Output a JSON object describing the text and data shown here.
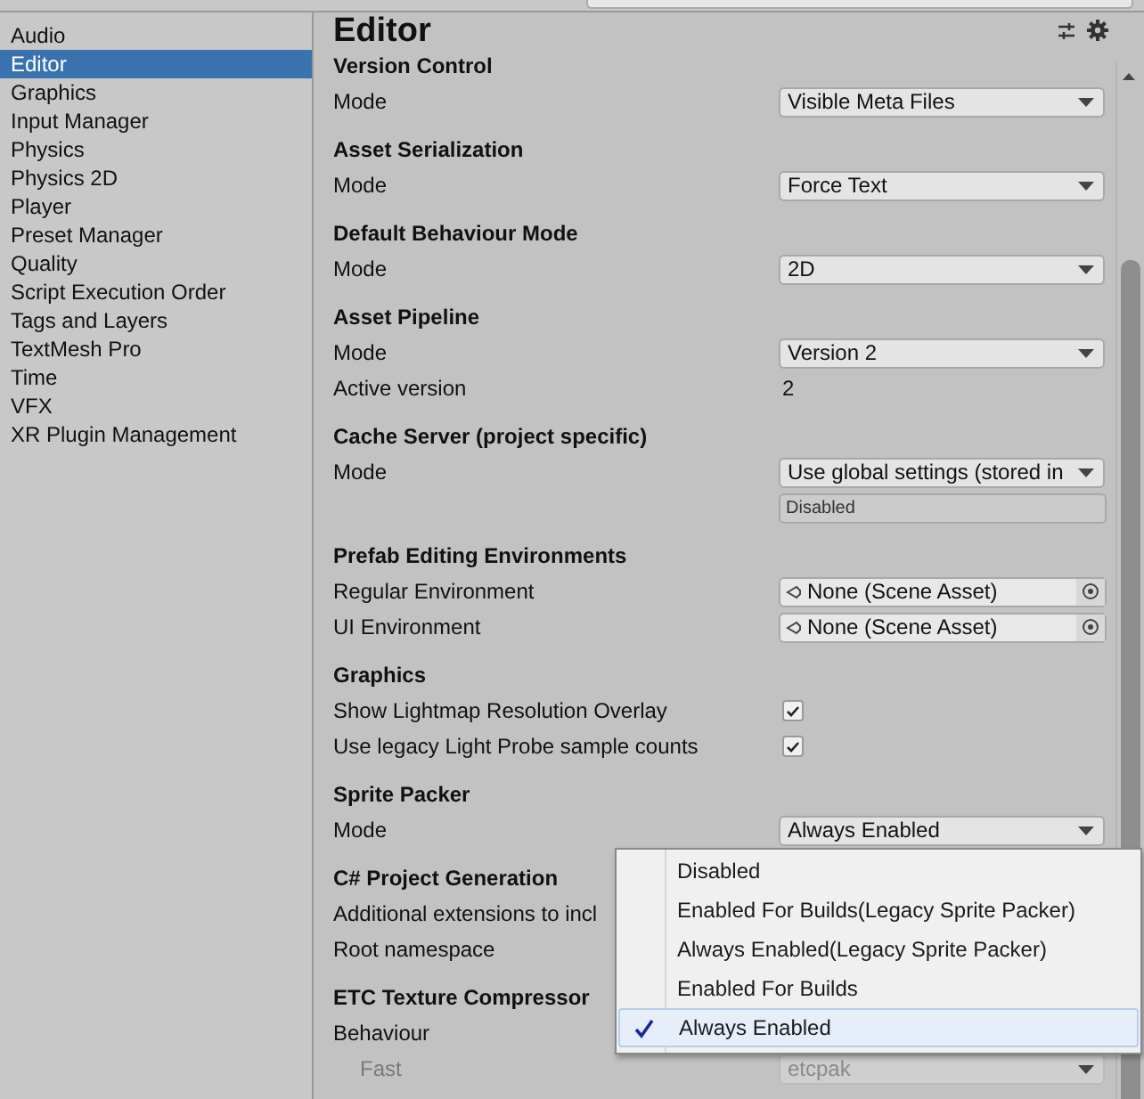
{
  "sidebar": {
    "items": [
      {
        "label": "Audio",
        "selected": false
      },
      {
        "label": "Editor",
        "selected": true
      },
      {
        "label": "Graphics",
        "selected": false
      },
      {
        "label": "Input Manager",
        "selected": false
      },
      {
        "label": "Physics",
        "selected": false
      },
      {
        "label": "Physics 2D",
        "selected": false
      },
      {
        "label": "Player",
        "selected": false
      },
      {
        "label": "Preset Manager",
        "selected": false
      },
      {
        "label": "Quality",
        "selected": false
      },
      {
        "label": "Script Execution Order",
        "selected": false
      },
      {
        "label": "Tags and Layers",
        "selected": false
      },
      {
        "label": "TextMesh Pro",
        "selected": false
      },
      {
        "label": "Time",
        "selected": false
      },
      {
        "label": "VFX",
        "selected": false
      },
      {
        "label": "XR Plugin Management",
        "selected": false
      }
    ]
  },
  "panel": {
    "title": "Editor",
    "sections": [
      {
        "title": "Version Control",
        "rows": [
          {
            "kind": "dropdown",
            "label": "Mode",
            "value": "Visible Meta Files"
          }
        ]
      },
      {
        "title": "Asset Serialization",
        "rows": [
          {
            "kind": "dropdown",
            "label": "Mode",
            "value": "Force Text"
          }
        ]
      },
      {
        "title": "Default Behaviour Mode",
        "rows": [
          {
            "kind": "dropdown",
            "label": "Mode",
            "value": "2D"
          }
        ]
      },
      {
        "title": "Asset Pipeline",
        "rows": [
          {
            "kind": "dropdown",
            "label": "Mode",
            "value": "Version 2"
          },
          {
            "kind": "text",
            "label": "Active version",
            "value": "2"
          }
        ]
      },
      {
        "title": "Cache Server (project specific)",
        "rows": [
          {
            "kind": "dropdown",
            "label": "Mode",
            "value": "Use global settings (stored in"
          },
          {
            "kind": "status",
            "value": "Disabled"
          }
        ]
      },
      {
        "title": "Prefab Editing Environments",
        "rows": [
          {
            "kind": "object",
            "label": "Regular Environment",
            "value": "None (Scene Asset)"
          },
          {
            "kind": "object",
            "label": "UI Environment",
            "value": "None (Scene Asset)"
          }
        ]
      },
      {
        "title": "Graphics",
        "rows": [
          {
            "kind": "checkbox",
            "label": "Show Lightmap Resolution Overlay",
            "checked": true
          },
          {
            "kind": "checkbox",
            "label": "Use legacy Light Probe sample counts",
            "checked": true
          }
        ]
      },
      {
        "title": "Sprite Packer",
        "rows": [
          {
            "kind": "dropdown",
            "label": "Mode",
            "value": "Always Enabled"
          }
        ]
      },
      {
        "title": "C# Project Generation",
        "rows": [
          {
            "kind": "label",
            "label": "Additional extensions to incl"
          },
          {
            "kind": "label",
            "label": "Root namespace"
          }
        ]
      },
      {
        "title": "ETC Texture Compressor",
        "rows": [
          {
            "kind": "label",
            "label": "Behaviour"
          },
          {
            "kind": "dropdown",
            "label": "Fast",
            "value": "etcpak",
            "disabled": true
          }
        ]
      }
    ]
  },
  "popup": {
    "items": [
      {
        "label": "Disabled",
        "selected": false
      },
      {
        "label": "Enabled For Builds(Legacy Sprite Packer)",
        "selected": false
      },
      {
        "label": "Always Enabled(Legacy Sprite Packer)",
        "selected": false
      },
      {
        "label": "Enabled For Builds",
        "selected": false
      },
      {
        "label": "Always Enabled",
        "selected": true
      }
    ]
  }
}
